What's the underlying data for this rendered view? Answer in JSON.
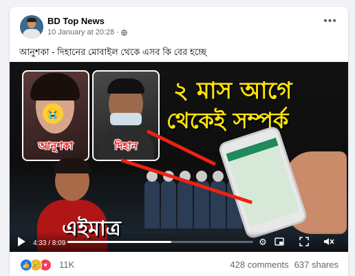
{
  "post": {
    "page_name": "BD Top News",
    "timestamp": "10 January at 20:28",
    "privacy_icon": "globe-icon",
    "caption": "আনুশকা - দিহানের মোবাইল থেকে এসব কি বের হচ্ছে"
  },
  "video": {
    "title_line1": "২ মাস আগে",
    "title_line2": "থেকেই সম্পর্ক",
    "label_left": "আনুশকা",
    "label_right": "দিহান",
    "breaking_text": "এইমাত্র",
    "time_display": "4:33 / 8:09",
    "progress": 0.56
  },
  "footer": {
    "reaction_count": "11K",
    "comments": "428 comments",
    "shares": "637 shares"
  },
  "colors": {
    "brand_blue": "#1877f2",
    "title_yellow": "#ffe600",
    "label_red": "#e11111"
  }
}
